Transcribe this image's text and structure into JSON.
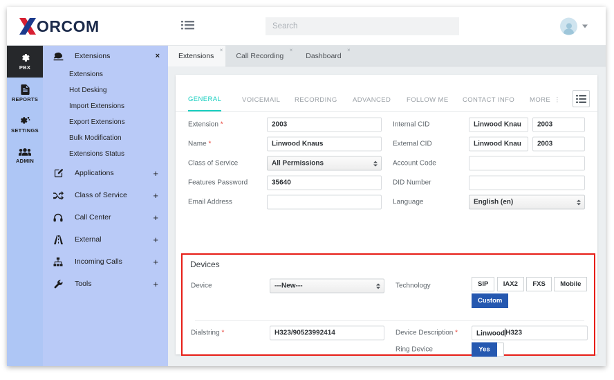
{
  "brand": {
    "x_letter": "X",
    "name": "ORCOM"
  },
  "topbar": {
    "menu_icon": "list-icon",
    "search_placeholder": "Search",
    "search_value": "",
    "avatar_icon": "user-avatar-icon",
    "caret_icon": "chevron-down-icon"
  },
  "rail": {
    "items": [
      {
        "label": "PBX",
        "icon": "gear-icon",
        "active": true
      },
      {
        "label": "REPORTS",
        "icon": "document-icon",
        "active": false
      },
      {
        "label": "SETTINGS",
        "icon": "gears-icon",
        "active": false
      },
      {
        "label": "ADMIN",
        "icon": "users-icon",
        "active": false
      }
    ]
  },
  "menu": {
    "header": {
      "label": "Extensions",
      "icon": "phone-icon",
      "close": "×"
    },
    "sub_items": [
      "Extensions",
      "Hot Desking",
      "Import Extensions",
      "Export Extensions",
      "Bulk Modification",
      "Extensions Status"
    ],
    "groups": [
      {
        "label": "Applications",
        "icon": "edit-square-icon",
        "expand": "+"
      },
      {
        "label": "Class of Service",
        "icon": "shuffle-icon",
        "expand": "+"
      },
      {
        "label": "Call Center",
        "icon": "headset-icon",
        "expand": "+"
      },
      {
        "label": "External",
        "icon": "road-icon",
        "expand": "+"
      },
      {
        "label": "Incoming Calls",
        "icon": "sitemap-icon",
        "expand": "+"
      },
      {
        "label": "Tools",
        "icon": "wrench-icon",
        "expand": "+"
      }
    ]
  },
  "tabs": [
    {
      "label": "Extensions",
      "close": "×",
      "active": true
    },
    {
      "label": "Call Recording",
      "close": "×",
      "active": false
    },
    {
      "label": "Dashboard",
      "close": "×",
      "active": false
    }
  ],
  "subtabs": {
    "items": [
      {
        "label": "GENERAL",
        "active": true
      },
      {
        "label": "VOICEMAIL",
        "active": false
      },
      {
        "label": "RECORDING",
        "active": false
      },
      {
        "label": "ADVANCED",
        "active": false
      },
      {
        "label": "FOLLOW ME",
        "active": false
      },
      {
        "label": "CONTACT INFO",
        "active": false
      },
      {
        "label": "MORE",
        "active": false
      }
    ],
    "more_dots": "⋮",
    "list_button_icon": "list-view-icon"
  },
  "form": {
    "left": [
      {
        "label": "Extension",
        "required": true,
        "type": "text",
        "value": "2003"
      },
      {
        "label": "Name",
        "required": true,
        "type": "text",
        "value": "Linwood Knaus"
      },
      {
        "label": "Class of Service",
        "required": false,
        "type": "select",
        "value": "All Permissions"
      },
      {
        "label": "Features Password",
        "required": false,
        "type": "text",
        "value": "35640"
      },
      {
        "label": "Email Address",
        "required": false,
        "type": "text",
        "value": ""
      }
    ],
    "right": [
      {
        "label": "Internal CID",
        "required": false,
        "type": "text2",
        "value": "Linwood Knau",
        "value2": "2003"
      },
      {
        "label": "External CID",
        "required": false,
        "type": "text2",
        "value": "Linwood Knau",
        "value2": "2003"
      },
      {
        "label": "Account Code",
        "required": false,
        "type": "text",
        "value": ""
      },
      {
        "label": "DID Number",
        "required": false,
        "type": "text",
        "value": ""
      },
      {
        "label": "Language",
        "required": false,
        "type": "select",
        "value": "English (en)"
      }
    ]
  },
  "devices": {
    "title": "Devices",
    "device_label": "Device",
    "device_value": "---New---",
    "dialstring_label": "Dialstring",
    "dialstring_required": true,
    "dialstring_value": "H323/90523992414",
    "technology_label": "Technology",
    "technology_options": [
      "SIP",
      "IAX2",
      "FXS",
      "Mobile",
      "Custom"
    ],
    "technology_selected": "Custom",
    "description_label": "Device Description",
    "description_required": true,
    "description_value_before_cursor": "Linwood",
    "description_value_after_cursor": " H323",
    "ring_label": "Ring Device",
    "ring_value": "Yes"
  },
  "colors": {
    "rail_bg": "#aec6f5",
    "menu_bg": "#b9caf7",
    "rail_active": "#26282b",
    "accent_teal": "#18cfc0",
    "accent_blue": "#2558b0",
    "highlight_red": "#e71d16",
    "required_red": "#e8453c"
  }
}
